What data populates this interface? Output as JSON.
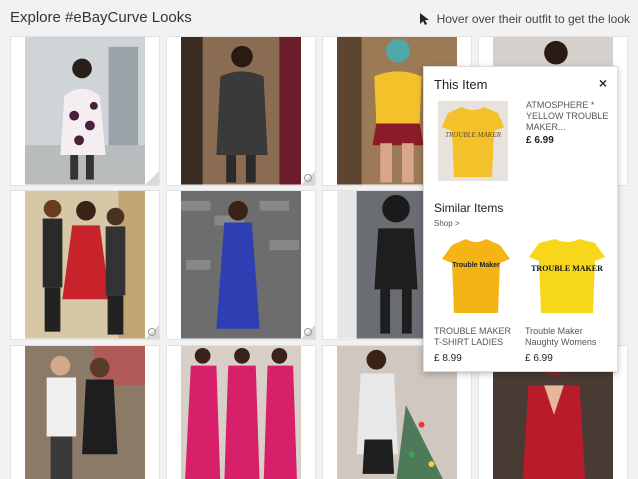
{
  "header": {
    "title": "Explore #eBayCurve Looks",
    "hint": "Hover over their outfit to get the look"
  },
  "popup": {
    "title": "This Item",
    "close": "×",
    "item": {
      "name": "ATMOSPHERE * YELLOW TROUBLE MAKER...",
      "price": "£ 6.99",
      "print": "TROUBLE MAKER"
    },
    "similar_title": "Similar Items",
    "shop_link": "Shop >",
    "similar": [
      {
        "name": "TROUBLE MAKER T-SHIRT LADIES",
        "price": "£ 8.99",
        "print": "Trouble Maker"
      },
      {
        "name": "Trouble Maker Naughty Womens",
        "price": "£ 6.99",
        "print": "TROUBLE MAKER"
      }
    ]
  },
  "colors": {
    "background": "#f2f2f2",
    "shirt_yellow": "#f3c12a",
    "dress_red": "#c8222a",
    "dress_blue": "#2e3fb3",
    "dress_pink": "#d81f6a"
  },
  "tiles_count": 16
}
